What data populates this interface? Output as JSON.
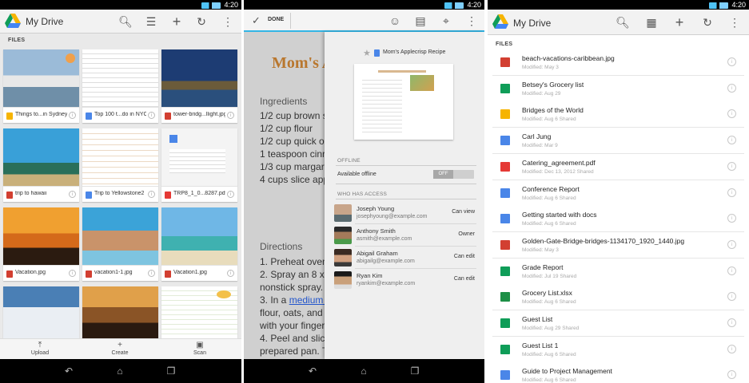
{
  "colors": {
    "accent": "#33b5e5",
    "doc_title": "#b9772e",
    "link": "#2255cc"
  },
  "status": {
    "time": "4:20"
  },
  "grid_screen": {
    "title": "My Drive",
    "section": "FILES",
    "tiles": [
      {
        "name": "Things to...in Sydney",
        "icon": "slides-icon",
        "color": "#f6b400"
      },
      {
        "name": "Top 100 t...do in NYC",
        "icon": "docs-icon",
        "color": "#4a86e8"
      },
      {
        "name": "tower-bridg...llight.jpg",
        "icon": "image-icon",
        "color": "#d23f31"
      },
      {
        "name": "trip to hawaii",
        "icon": "image-icon",
        "color": "#d23f31"
      },
      {
        "name": "Trip to Yellowstone2",
        "icon": "docs-icon",
        "color": "#4a86e8"
      },
      {
        "name": "TRP8_1_0...8287.pdf",
        "icon": "pdf-icon",
        "color": "#e53935"
      },
      {
        "name": "Vacation.jpg",
        "icon": "image-icon",
        "color": "#d23f31"
      },
      {
        "name": "vacation1-1.jpg",
        "icon": "image-icon",
        "color": "#d23f31"
      },
      {
        "name": "Vacation1.jpg",
        "icon": "image-icon",
        "color": "#d23f31"
      }
    ],
    "bottom": {
      "upload": "Upload",
      "create": "Create",
      "scan": "Scan"
    }
  },
  "detail_screen": {
    "done_label": "DONE",
    "doc": {
      "title": "Mom's A",
      "ingredients_heading": "Ingredients",
      "ingredients": [
        "1/2 cup brown s",
        "1/2 cup flour",
        "1/2 cup quick o",
        "1 teaspoon cinr",
        "1/3 cup margar",
        "4 cups slice app"
      ],
      "directions_heading": "Directions",
      "directions": [
        "1. Preheat oven t",
        "2. Spray an 8 x 8",
        "nonstick spray.",
        "flour, oats, and c",
        "with your fingers",
        "4. Peel and slice",
        "prepared pan. To"
      ],
      "line3_prefix": "3. In a",
      "line3_link": "medium b"
    },
    "panel": {
      "file_title": "Mom's Applecrisp Recipe",
      "offline_heading": "OFFLINE",
      "available_offline": "Available offline",
      "toggle_state": "OFF",
      "access_heading": "WHO HAS ACCESS",
      "people": [
        {
          "name": "Joseph Young",
          "email": "josephyoung@example.com",
          "role": "Can view"
        },
        {
          "name": "Anthony Smith",
          "email": "asmith@example.com",
          "role": "Owner"
        },
        {
          "name": "Abigail Graham",
          "email": "abigailg@example.com",
          "role": "Can edit"
        },
        {
          "name": "Ryan Kim",
          "email": "ryankim@example.com",
          "role": "Can edit"
        }
      ]
    }
  },
  "list_screen": {
    "title": "My Drive",
    "section": "FILES",
    "rows": [
      {
        "name": "beach-vacations-caribbean.jpg",
        "meta": "Modified: May 3",
        "icon": "image-icon",
        "color": "#d23f31"
      },
      {
        "name": "Betsey's Grocery list",
        "meta": "Modified: Aug 29",
        "icon": "sheets-icon",
        "color": "#0f9d58"
      },
      {
        "name": "Bridges of the World",
        "meta": "Modified: Aug 6  Shared",
        "icon": "slides-icon",
        "color": "#f6b400"
      },
      {
        "name": "Carl Jung",
        "meta": "Modified: Mar 9",
        "icon": "docs-icon",
        "color": "#4a86e8"
      },
      {
        "name": "Catering_agreement.pdf",
        "meta": "Modified: Dec 13, 2012  Shared",
        "icon": "pdf-icon",
        "color": "#e53935"
      },
      {
        "name": "Conference Report",
        "meta": "Modified: Aug 6  Shared",
        "icon": "docs-icon",
        "color": "#4a86e8"
      },
      {
        "name": "Getting started with docs",
        "meta": "Modified: Aug 6  Shared",
        "icon": "docs-icon",
        "color": "#4a86e8"
      },
      {
        "name": "Golden-Gate-Bridge-bridges-1134170_1920_1440.jpg",
        "meta": "Modified: May 3",
        "icon": "image-icon",
        "color": "#d23f31"
      },
      {
        "name": "Grade Report",
        "meta": "Modified: Jul 19  Shared",
        "icon": "sheets-icon",
        "color": "#0f9d58"
      },
      {
        "name": "Grocery List.xlsx",
        "meta": "Modified: Aug 6  Shared",
        "icon": "excel-icon",
        "color": "#1d8f46"
      },
      {
        "name": "Guest List",
        "meta": "Modified: Aug 29  Shared",
        "icon": "sheets-icon",
        "color": "#0f9d58"
      },
      {
        "name": "Guest List 1",
        "meta": "Modified: Aug 6  Shared",
        "icon": "sheets-icon",
        "color": "#0f9d58"
      },
      {
        "name": "Guide to Project Management",
        "meta": "Modified: Aug 6  Shared",
        "icon": "docs-icon",
        "color": "#4a86e8"
      }
    ]
  }
}
